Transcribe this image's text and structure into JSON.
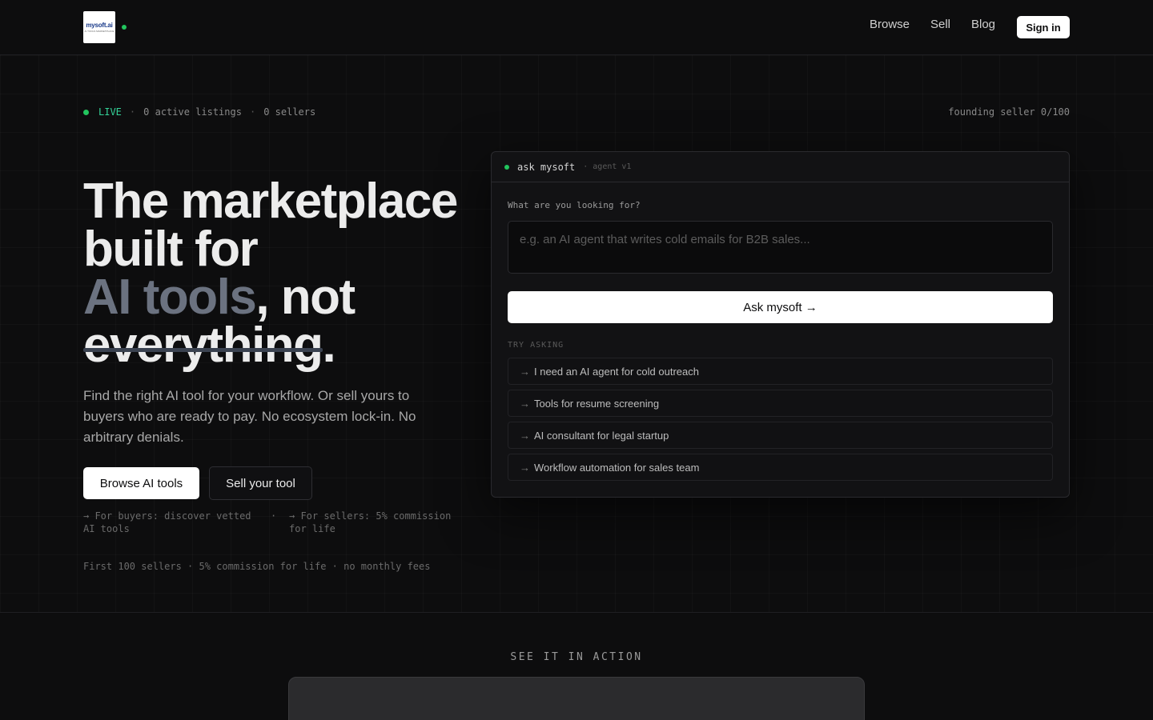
{
  "header": {
    "logo_text": "mysoft.ai",
    "logo_subtext": "AI TOOLS MARKETPLACE",
    "nav": [
      "Browse",
      "Sell",
      "Blog"
    ],
    "signin_label": "Sign in"
  },
  "status": {
    "live": "LIVE",
    "listings": "0 active listings",
    "sellers": "0 sellers",
    "separator": "·",
    "founding": "founding seller 0/100"
  },
  "hero": {
    "line1": "The marketplace",
    "line2": "built for",
    "line3_muted": "AI tools",
    "line3_rest": ", not",
    "line4_strike": "everything",
    "line4_rest": ".",
    "subtitle": "Find the right AI tool for your workflow. Or sell yours to buyers who are ready to pay. No ecosystem lock-in. No arbitrary denials.",
    "primary_button": "Browse AI tools",
    "secondary_button": "Sell your tool",
    "note_buyers": "→ For buyers: discover vetted AI tools",
    "note_separator": "·",
    "note_sellers": "→ For sellers: 5% commission for life",
    "bottom_note": "First 100 sellers · 5% commission for life · no monthly fees"
  },
  "agent": {
    "title": "ask mysoft",
    "subtitle": "· agent v1",
    "question_label": "What are you looking for?",
    "input_value": "",
    "input_placeholder": "e.g. an AI agent that writes cold emails for B2B sales...",
    "ask_button": "Ask mysoft →",
    "try_label": "TRY ASKING",
    "suggestions": [
      "I need an AI agent for cold outreach",
      "Tools for resume screening",
      "AI consultant for legal startup",
      "Workflow automation for sales team"
    ],
    "arrow": "→"
  },
  "demo": {
    "label": "SEE IT IN ACTION"
  },
  "colors": {
    "background": "#0d0d0e",
    "accent_green": "#22c55e",
    "muted_text": "#6b7280"
  }
}
